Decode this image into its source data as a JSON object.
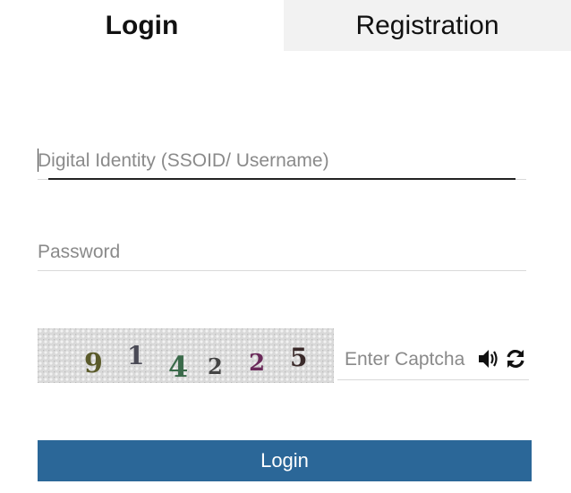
{
  "tabs": {
    "login_label": "Login",
    "registration_label": "Registration"
  },
  "form": {
    "username_placeholder": "Digital Identity (SSOID/ Username)",
    "username_value": "",
    "password_placeholder": "Password",
    "password_value": "",
    "captcha_digits": [
      "9",
      "1",
      "4",
      "2",
      "2",
      "5"
    ],
    "captcha_placeholder": "Enter Captcha",
    "captcha_value": "",
    "audio_icon": "speaker-icon",
    "refresh_icon": "refresh-icon",
    "submit_label": "Login"
  },
  "colors": {
    "primary": "#2b6798",
    "inactive_tab_bg": "#f2f2f2"
  }
}
